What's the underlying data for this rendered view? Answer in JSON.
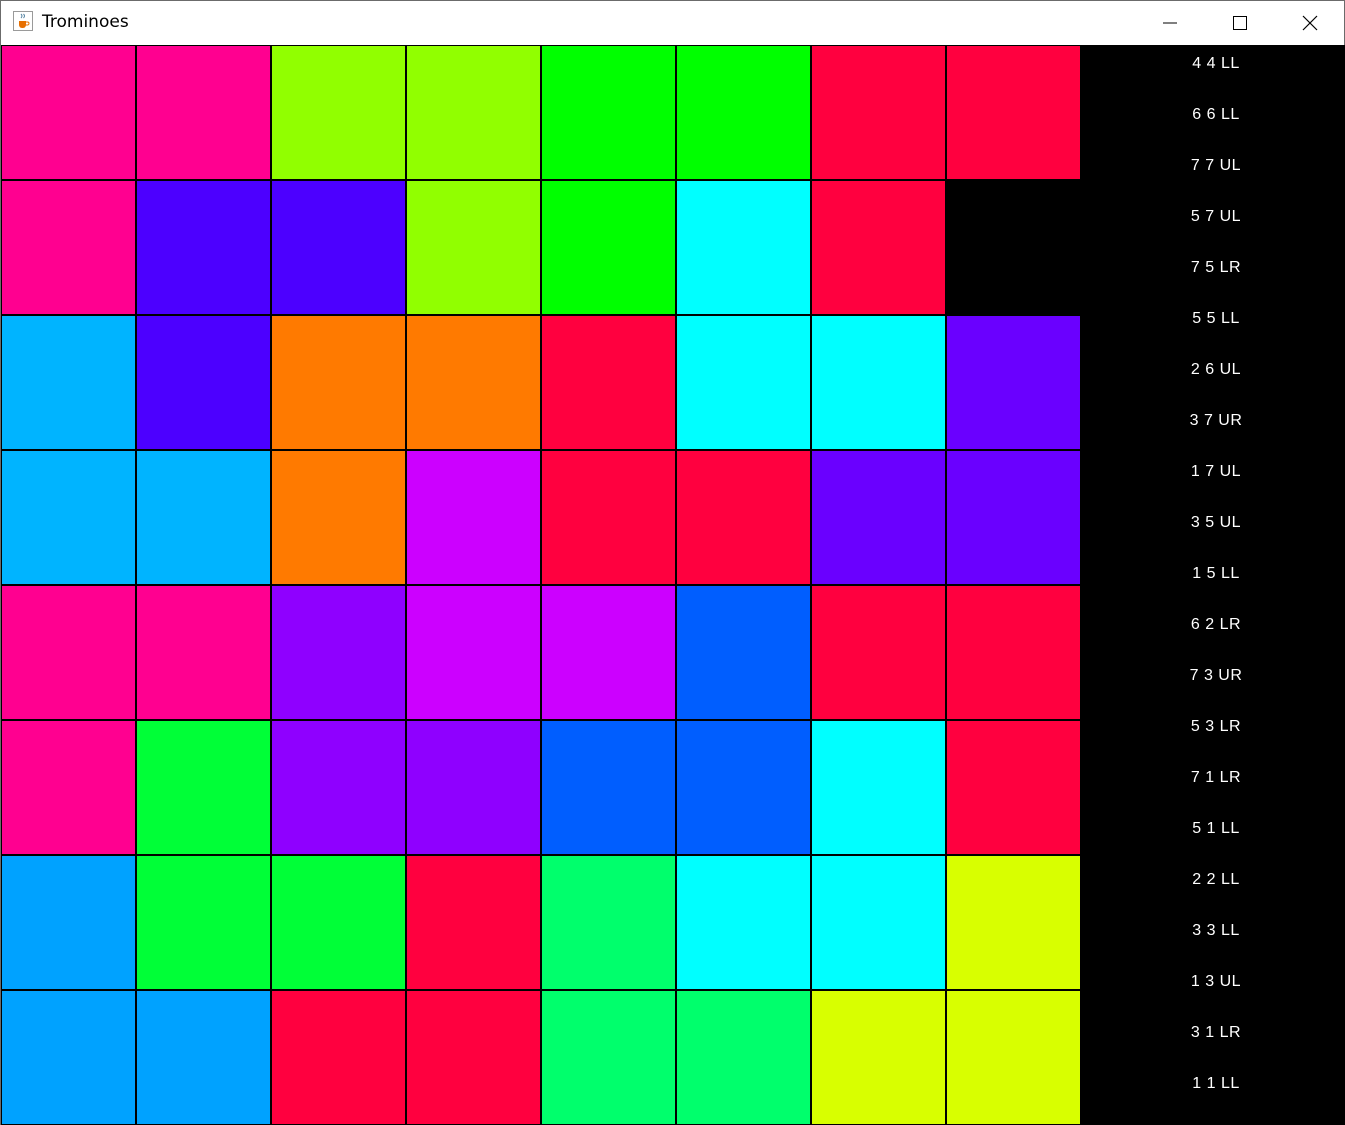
{
  "window": {
    "title": "Trominoes",
    "icons": {
      "app": "java-cup-icon",
      "minimize": "minimize-icon",
      "maximize": "maximize-icon",
      "close": "close-icon"
    }
  },
  "board": {
    "rows": 8,
    "cols": 8,
    "cells": [
      [
        "#ff0090",
        "#ff0090",
        "#91ff00",
        "#91ff00",
        "#00ff00",
        "#00ff00",
        "#ff003f",
        "#ff003f"
      ],
      [
        "#ff0090",
        "#4c00ff",
        "#4c00ff",
        "#91ff00",
        "#00ff00",
        "#00ffff",
        "#ff003f",
        "#000000"
      ],
      [
        "#00b4ff",
        "#4c00ff",
        "#ff7a00",
        "#ff7a00",
        "#ff003f",
        "#00ffff",
        "#00ffff",
        "#6a00ff"
      ],
      [
        "#00b4ff",
        "#00b4ff",
        "#ff7a00",
        "#cc00ff",
        "#ff003f",
        "#ff003f",
        "#6a00ff",
        "#6a00ff"
      ],
      [
        "#ff0090",
        "#ff0090",
        "#8f00ff",
        "#cc00ff",
        "#cc00ff",
        "#005eff",
        "#ff003f",
        "#ff003f"
      ],
      [
        "#ff0090",
        "#00ff37",
        "#8f00ff",
        "#8f00ff",
        "#005eff",
        "#005eff",
        "#00ffff",
        "#ff003f"
      ],
      [
        "#00a2ff",
        "#00ff37",
        "#00ff37",
        "#ff003f",
        "#00ff6c",
        "#00ffff",
        "#00ffff",
        "#d8ff00"
      ],
      [
        "#00a2ff",
        "#00a2ff",
        "#ff003f",
        "#ff003f",
        "#00ff6c",
        "#00ff6c",
        "#d8ff00",
        "#d8ff00"
      ]
    ]
  },
  "moves": [
    "4 4 LL",
    "6 6 LL",
    "7 7 UL",
    "5 7 UL",
    "7 5 LR",
    "5 5 LL",
    "2 6 UL",
    "3 7 UR",
    "1 7 UL",
    "3 5 UL",
    "1 5 LL",
    "6 2 LR",
    "7 3 UR",
    "5 3 LR",
    "7 1 LR",
    "5 1 LL",
    "2 2 LL",
    "3 3 LL",
    "1 3 UL",
    "3 1 LR",
    "1 1 LL"
  ]
}
